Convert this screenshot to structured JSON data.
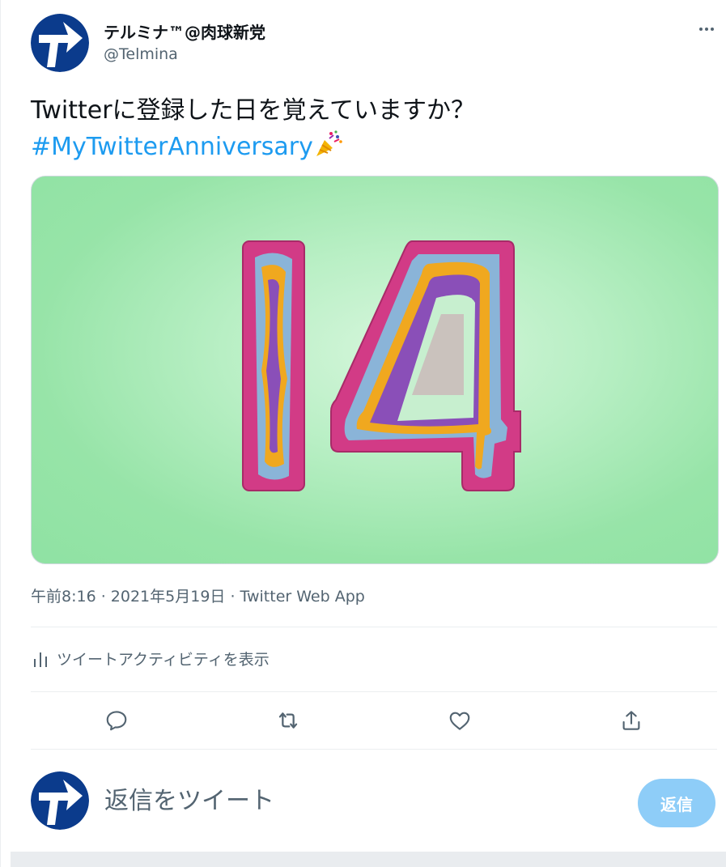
{
  "author": {
    "display_name": "テルミナ™@肉球新党",
    "handle": "@Telmina"
  },
  "tweet": {
    "text": "Twitterに登録した日を覚えていますか？",
    "hashtag": "#MyTwitterAnniversary",
    "emoji": "party-popper",
    "image_number": "14",
    "timestamp": "午前8:16 · 2021年5月19日 · Twitter Web App",
    "activity_label": "ツイートアクティビティを表示"
  },
  "reply": {
    "placeholder": "返信をツイート",
    "button_label": "返信"
  },
  "colors": {
    "link": "#1d9bf0",
    "secondary_text": "#536471",
    "reply_button_disabled": "#8ecdf8",
    "card_background": "#8fe2a3",
    "numeral_magenta": "#d23b86"
  },
  "icons": {
    "more": "more-icon",
    "activity": "bar-chart-icon",
    "reply": "reply-icon",
    "retweet": "retweet-icon",
    "like": "heart-icon",
    "share": "share-icon"
  }
}
